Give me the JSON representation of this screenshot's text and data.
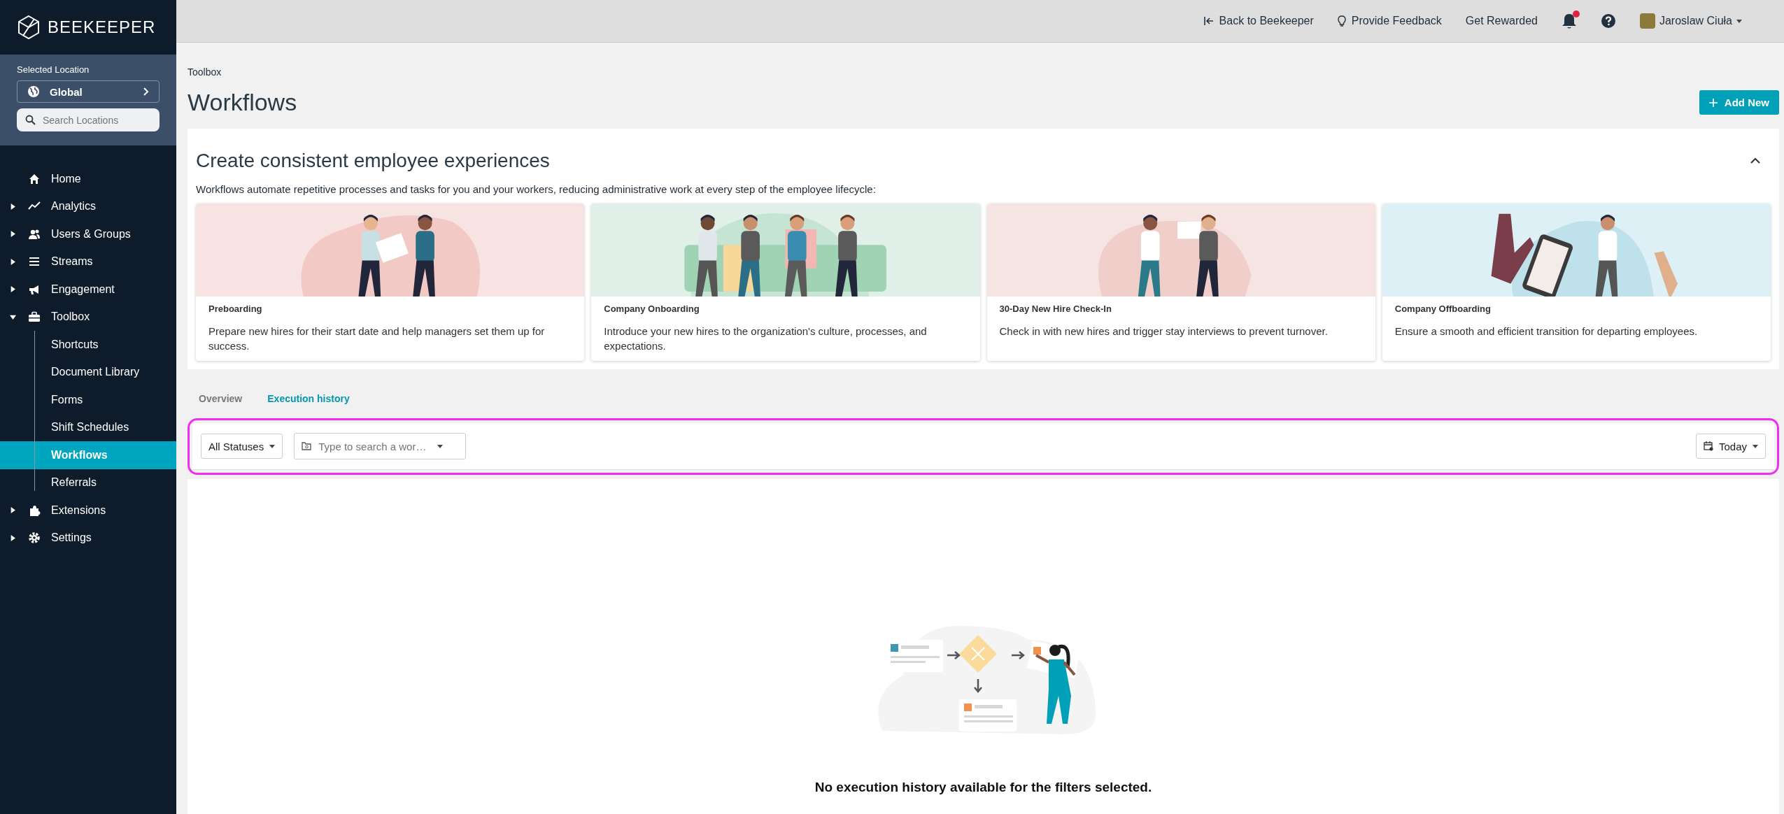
{
  "brand": {
    "name": "BEEKEEPER"
  },
  "location": {
    "label": "Selected Location",
    "value": "Global",
    "search": {
      "placeholder": "Search Locations"
    }
  },
  "sidebar": {
    "items": [
      {
        "label": "Home",
        "kind": "plain"
      },
      {
        "label": "Analytics",
        "kind": "group",
        "expanded": false
      },
      {
        "label": "Users & Groups",
        "kind": "group",
        "expanded": false
      },
      {
        "label": "Streams",
        "kind": "group",
        "expanded": false
      },
      {
        "label": "Engagement",
        "kind": "group",
        "expanded": false
      },
      {
        "label": "Toolbox",
        "kind": "group",
        "expanded": true,
        "children": [
          {
            "label": "Shortcuts",
            "selected": false
          },
          {
            "label": "Document Library",
            "selected": false
          },
          {
            "label": "Forms",
            "selected": false
          },
          {
            "label": "Shift Schedules",
            "selected": false
          },
          {
            "label": "Workflows",
            "selected": true
          },
          {
            "label": "Referrals",
            "selected": false
          }
        ]
      },
      {
        "label": "Extensions",
        "kind": "group",
        "expanded": false
      },
      {
        "label": "Settings",
        "kind": "group",
        "expanded": false
      }
    ]
  },
  "topbar": {
    "links": [
      "Back to Beekeeper",
      "Provide Feedback",
      "Get Rewarded"
    ],
    "notifications": {
      "unread": true
    },
    "user": {
      "name": "Jaroslaw Ciuła"
    }
  },
  "page": {
    "breadcrumb": "Toolbox",
    "title": "Workflows",
    "add_button": "Add New"
  },
  "intro": {
    "title": "Create consistent employee experiences",
    "expanded": true,
    "description": "Workflows automate repetitive processes and tasks for you and your workers, reducing administrative work at every step of the employee lifecycle:",
    "templates": [
      {
        "title": "Preboarding",
        "description": "Prepare new hires for their start date and help managers set them up for success."
      },
      {
        "title": "Company Onboarding",
        "description": "Introduce your new hires to the organization's culture, processes, and expectations."
      },
      {
        "title": "30-Day New Hire Check-In",
        "description": "Check in with new hires and trigger stay interviews to prevent turnover."
      },
      {
        "title": "Company Offboarding",
        "description": "Ensure a smooth and efficient transition for departing employees."
      }
    ]
  },
  "tabs": [
    {
      "label": "Overview",
      "selected": false
    },
    {
      "label": "Execution history",
      "selected": true
    }
  ],
  "filters": {
    "status": "All Statuses",
    "workflow_search": {
      "placeholder": "Type to search a wor…"
    },
    "date": "Today",
    "highlighted": true
  },
  "empty_state": {
    "message": "No execution history available for the filters selected."
  }
}
